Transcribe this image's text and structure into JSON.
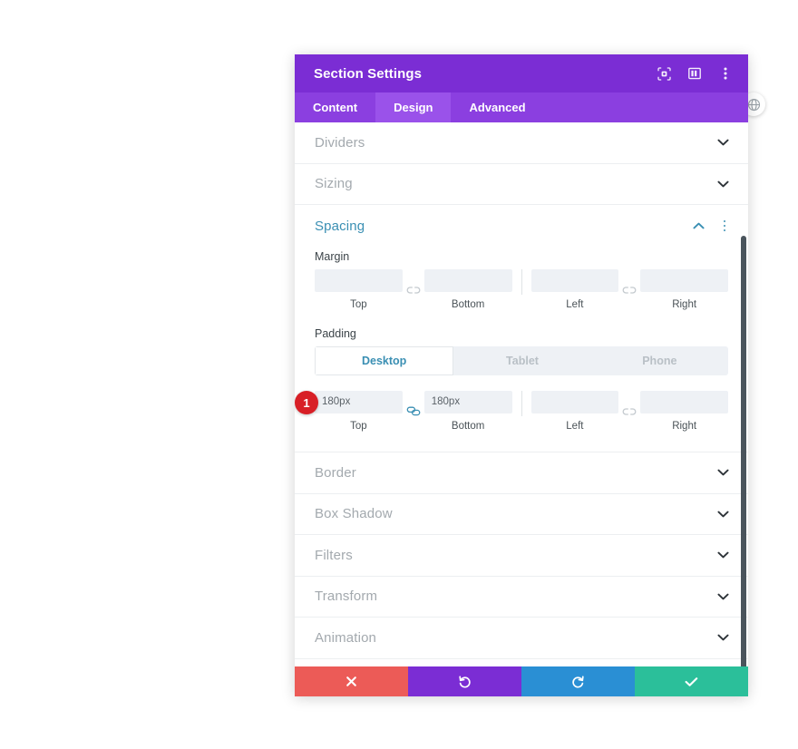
{
  "window": {
    "title": "Section Settings",
    "header_icons": [
      {
        "name": "focus-icon",
        "label": "Focus"
      },
      {
        "name": "layout-panel-icon",
        "label": "Layout"
      },
      {
        "name": "more-vertical-icon",
        "label": "More options"
      }
    ]
  },
  "tabs": [
    {
      "label": "Content",
      "active": false
    },
    {
      "label": "Design",
      "active": true
    },
    {
      "label": "Advanced",
      "active": false
    }
  ],
  "sections_above": [
    {
      "label": "Dividers",
      "state": "collapsed"
    },
    {
      "label": "Sizing",
      "state": "collapsed"
    }
  ],
  "spacing": {
    "label": "Spacing",
    "state": "expanded",
    "margin": {
      "label": "Margin",
      "linked_vertical": false,
      "linked_horizontal": false,
      "fields": [
        {
          "caption": "Top",
          "value": "",
          "placeholder": ""
        },
        {
          "caption": "Bottom",
          "value": "",
          "placeholder": ""
        },
        {
          "caption": "Left",
          "value": "",
          "placeholder": ""
        },
        {
          "caption": "Right",
          "value": "",
          "placeholder": ""
        }
      ]
    },
    "padding": {
      "label": "Padding",
      "badge": "1",
      "linked_vertical": true,
      "linked_horizontal": false,
      "device_tabs": [
        {
          "label": "Desktop",
          "active": true
        },
        {
          "label": "Tablet",
          "active": false
        },
        {
          "label": "Phone",
          "active": false
        }
      ],
      "fields": [
        {
          "caption": "Top",
          "value": "180px",
          "placeholder": ""
        },
        {
          "caption": "Bottom",
          "value": "180px",
          "placeholder": ""
        },
        {
          "caption": "Left",
          "value": "",
          "placeholder": ""
        },
        {
          "caption": "Right",
          "value": "",
          "placeholder": ""
        }
      ]
    }
  },
  "sections_below": [
    {
      "label": "Border",
      "state": "collapsed"
    },
    {
      "label": "Box Shadow",
      "state": "collapsed"
    },
    {
      "label": "Filters",
      "state": "collapsed"
    },
    {
      "label": "Transform",
      "state": "collapsed"
    },
    {
      "label": "Animation",
      "state": "collapsed"
    }
  ],
  "footer_buttons": [
    {
      "name": "close-button",
      "icon": "close-icon",
      "color": "#ec5b57"
    },
    {
      "name": "undo-button",
      "icon": "undo-icon",
      "color": "#7b2dd4"
    },
    {
      "name": "redo-button",
      "icon": "redo-icon",
      "color": "#2a8fd4"
    },
    {
      "name": "save-button",
      "icon": "check-icon",
      "color": "#2bbf9a"
    }
  ],
  "floating": {
    "globe_button": {
      "name": "globe-icon",
      "label": "Global"
    }
  },
  "colors": {
    "header_purple": "#7b2dd4",
    "tabbar_purple": "#8b3fe0",
    "tab_active_purple": "#9a52ea",
    "accent_teal": "#3a8fb3",
    "badge_red": "#d81f26",
    "input_bg": "#eef1f5",
    "muted_text": "#a3a9ae"
  }
}
